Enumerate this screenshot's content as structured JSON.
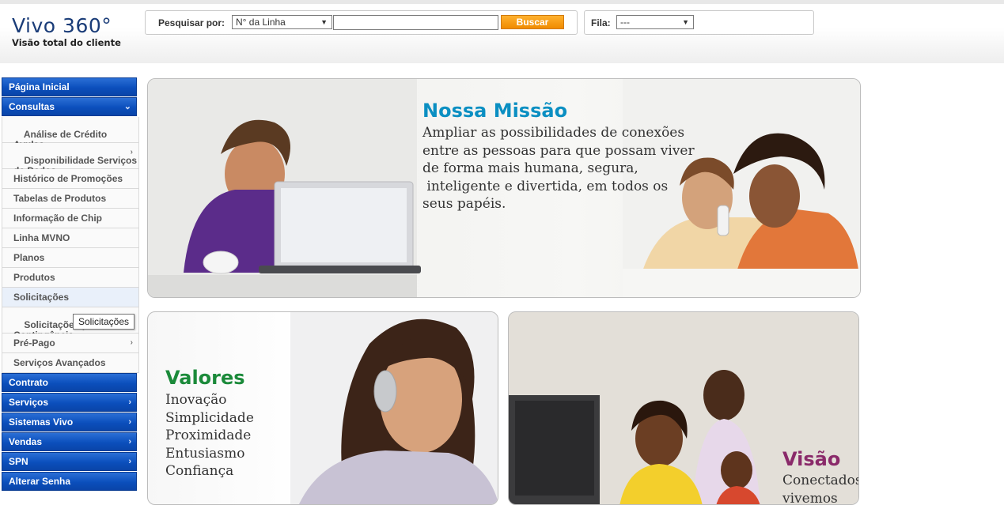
{
  "brand": {
    "title": "Vivo 360°",
    "subtitle": "Visão total do cliente",
    "color": "#1a3c78"
  },
  "search": {
    "label": "Pesquisar por:",
    "selected": "N° da Linha",
    "input_value": "",
    "button": "Buscar"
  },
  "fila": {
    "label": "Fila:",
    "selected": "---"
  },
  "sidebar": {
    "pagina_inicial": "Página Inicial",
    "consultas": "Consultas",
    "consultas_items": [
      "Análise de Crédito\nAvulsa",
      "Disponibilidade Serviços\nde Dados",
      "Histórico de Promoções",
      "Tabelas de Produtos",
      "Informação de Chip",
      "Linha MVNO",
      "Planos",
      "Produtos",
      "Solicitações",
      "Solicitações por\nContingência",
      "Pré-Pago",
      "Serviços Avançados"
    ],
    "main_items": [
      "Contrato",
      "Serviços",
      "Sistemas Vivo",
      "Vendas",
      "SPN",
      "Alterar Senha"
    ],
    "tooltip": "Solicitações"
  },
  "banners": {
    "missao": {
      "title": "Nossa Missão",
      "text": "Ampliar as possibilidades de conexões\nentre as pessoas para que possam viver\nde forma mais humana, segura,\n inteligente e divertida, em todos os\nseus papéis.",
      "title_color": "#0b8fc2"
    },
    "valores": {
      "title": "Valores",
      "text": "Inovação\nSimplicidade\nProximidade\nEntusiasmo\nConfiança",
      "title_color": "#1b8a3a"
    },
    "visao": {
      "title": "Visão",
      "text": "Conectados\nvivemos",
      "title_color": "#8a2a6a"
    }
  }
}
